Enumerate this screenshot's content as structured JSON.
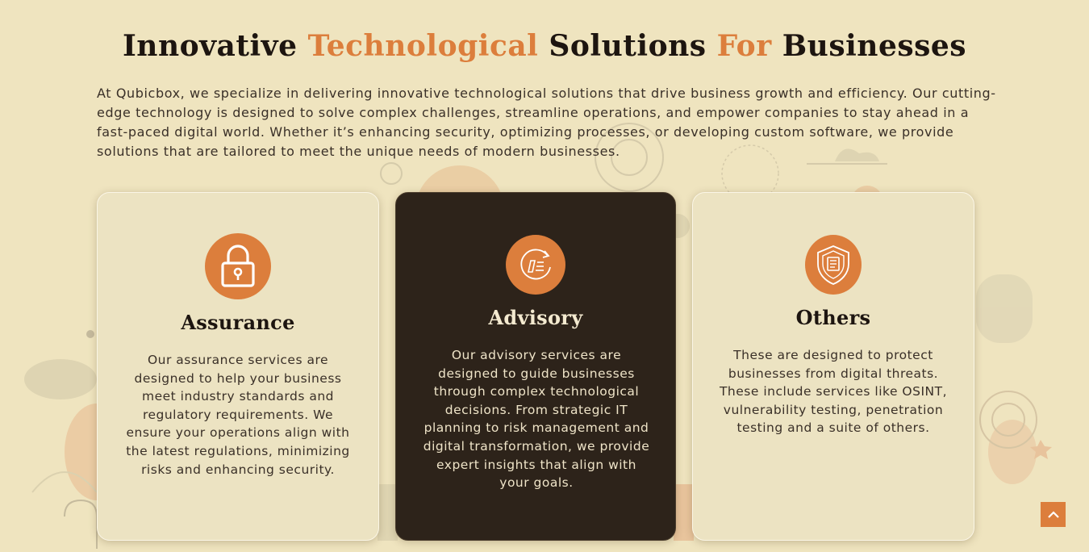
{
  "heading": {
    "word1": "Innovative",
    "word2": "Technological",
    "word3": "Solutions",
    "word4": "For",
    "word5": "Businesses"
  },
  "intro": "At Qubicbox, we specialize in delivering innovative technological solutions that drive business growth and efficiency. Our cutting-edge technology is designed to solve complex challenges, streamline operations, and empower companies to stay ahead in a fast-paced digital world. Whether it’s enhancing security, optimizing processes, or developing custom software, we provide solutions that are tailored to meet the unique needs of modern businesses.",
  "cards": [
    {
      "icon": "lock-icon",
      "title": "Assurance",
      "description": "Our assurance services are designed to help your business meet industry standards and regulatory requirements. We ensure your operations align with the latest regulations, minimizing risks and enhancing security."
    },
    {
      "icon": "document-refresh-icon",
      "title": "Advisory",
      "description": "Our advisory services are designed to guide businesses through complex technological decisions. From strategic IT planning to risk management and digital transformation, we provide expert insights that align with your goals."
    },
    {
      "icon": "shield-document-icon",
      "title": "Others",
      "description": "These are designed to protect businesses from digital threats. These include services like OSINT, vulnerability testing, penetration testing and a suite of others."
    }
  ],
  "scroll_top": {
    "icon": "chevron-up-icon"
  },
  "colors": {
    "background": "#efe4bf",
    "accent": "#dc7e3c",
    "dark_card": "#2d231a",
    "text": "#1d1510"
  }
}
